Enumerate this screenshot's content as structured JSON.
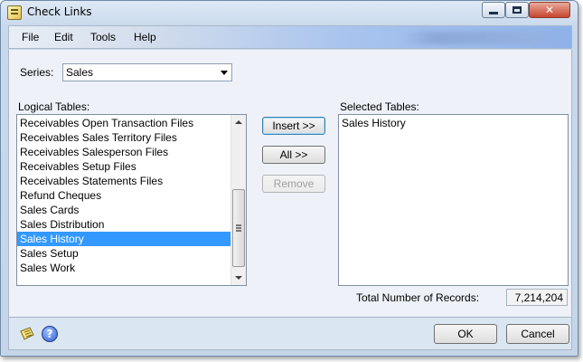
{
  "window": {
    "title": "Check Links"
  },
  "menu": {
    "items": [
      "File",
      "Edit",
      "Tools",
      "Help"
    ]
  },
  "series": {
    "label": "Series:",
    "value": "Sales"
  },
  "logical_tables": {
    "label": "Logical Tables:",
    "items": [
      "Receivables Open Transaction Files",
      "Receivables Sales Territory Files",
      "Receivables Salesperson Files",
      "Receivables Setup Files",
      "Receivables Statements Files",
      "Refund Cheques",
      "Sales Cards",
      "Sales Distribution",
      "Sales History",
      "Sales Setup",
      "Sales Work"
    ],
    "selected": "Sales History"
  },
  "selected_tables": {
    "label": "Selected Tables:",
    "items": [
      "Sales History"
    ]
  },
  "buttons": {
    "insert": "Insert >>",
    "all": "All >>",
    "remove": "Remove",
    "ok": "OK",
    "cancel": "Cancel"
  },
  "total": {
    "label": "Total Number of Records:",
    "value": "7,214,204"
  },
  "icons": {
    "note": "note-icon",
    "help": "help-icon"
  },
  "colors": {
    "selection": "#3399ff",
    "menubar_accent": "#8fb2ea"
  }
}
